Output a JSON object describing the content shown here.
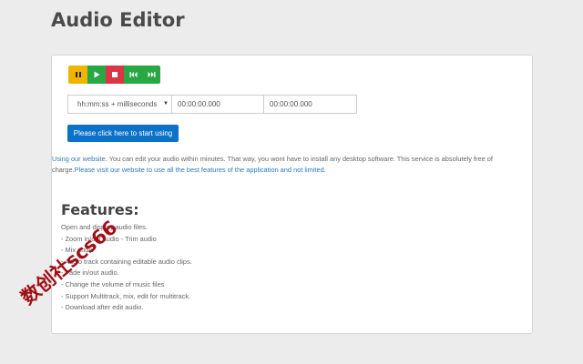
{
  "page": {
    "title": "Audio Editor"
  },
  "transport": {
    "buttons": [
      {
        "name": "pause",
        "icon": "pause-icon",
        "color": "#f0b400"
      },
      {
        "name": "play",
        "icon": "play-icon",
        "color": "#28a745"
      },
      {
        "name": "stop",
        "icon": "stop-icon",
        "color": "#dc3545"
      },
      {
        "name": "previous",
        "icon": "skip-back-icon",
        "color": "#28a745"
      },
      {
        "name": "next",
        "icon": "skip-forward-icon",
        "color": "#28a745"
      }
    ]
  },
  "time": {
    "format_selected": "hh:mm:ss + milliseconds",
    "start_value": "00:00:00.000",
    "end_value": "00:00:00.000"
  },
  "start_button": {
    "label": "Please click here to start using",
    "color": "#0b72c8"
  },
  "intro": {
    "link1": "Using our website",
    "text1": ". You can edit your audio within minutes. That way, you wont have to install any desktop software. This service is absolutely free of charge.",
    "link2": "Please visit our website to use all the best features of the application and not limited."
  },
  "features": {
    "title": "Features:",
    "items": [
      "Open and display audio files.",
      "- Zoom in/out audio - Trim audio",
      "- Mix audio",
      "- Audio track containing editable audio clips.",
      "- Fade in/out audio.",
      "- Change the volume of music files",
      "- Support Multitrack, mix, edit for multitrack.",
      "- Download after edit audio."
    ]
  },
  "watermark": {
    "text": "数创社scs66",
    "color": "#a50d15"
  }
}
